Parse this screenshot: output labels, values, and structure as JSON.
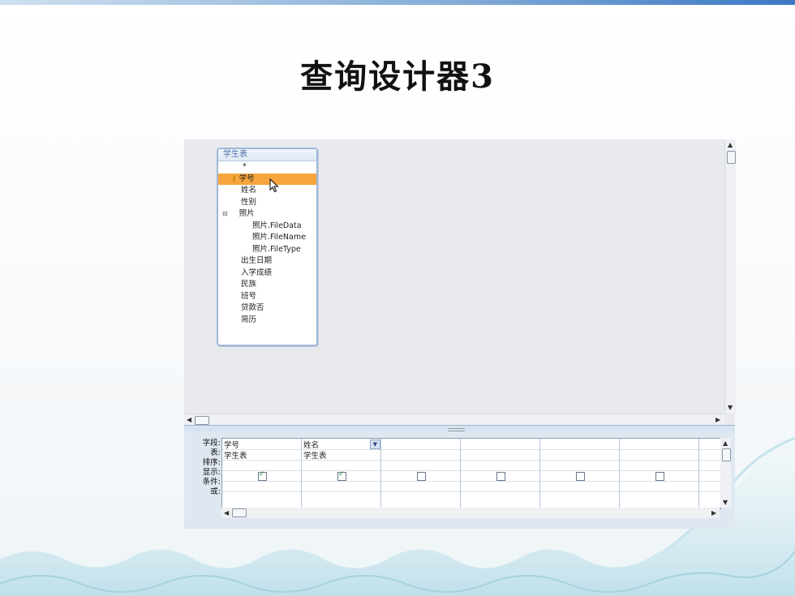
{
  "slide": {
    "title": "查询设计器3",
    "colors": {
      "accent": "#3b78c4",
      "highlight": "#f6a53c",
      "panel": "#e8eaee"
    }
  },
  "table_box": {
    "title": "学生表",
    "all_fields": "*",
    "fields": [
      {
        "label": "学号",
        "selected": true,
        "key": true,
        "indent": 0
      },
      {
        "label": "姓名",
        "indent": 0
      },
      {
        "label": "性别",
        "indent": 0
      },
      {
        "label": "照片",
        "indent": 0,
        "collapse": "⊟"
      },
      {
        "label": "照片.FileData",
        "indent": 1
      },
      {
        "label": "照片.FileName",
        "indent": 1
      },
      {
        "label": "照片.FileType",
        "indent": 1
      },
      {
        "label": "出生日期",
        "indent": 0
      },
      {
        "label": "入学成绩",
        "indent": 0
      },
      {
        "label": "民族",
        "indent": 0
      },
      {
        "label": "班号",
        "indent": 0
      },
      {
        "label": "贷款否",
        "indent": 0
      },
      {
        "label": "简历",
        "indent": 0
      }
    ]
  },
  "grid": {
    "row_labels": [
      "字段:",
      "表:",
      "排序:",
      "显示:",
      "条件:",
      "或:"
    ],
    "columns": [
      {
        "field": "学号",
        "table": "学生表",
        "show": true
      },
      {
        "field": "姓名",
        "table": "学生表",
        "show": true,
        "dropdown": true
      },
      {
        "field": "",
        "table": "",
        "show": false
      },
      {
        "field": "",
        "table": "",
        "show": false
      },
      {
        "field": "",
        "table": "",
        "show": false
      },
      {
        "field": "",
        "table": "",
        "show": false
      }
    ]
  },
  "icons": {
    "key": "primary-key-icon",
    "cursor": "mouse-pointer-icon",
    "dropdown": "chevron-down-icon"
  }
}
